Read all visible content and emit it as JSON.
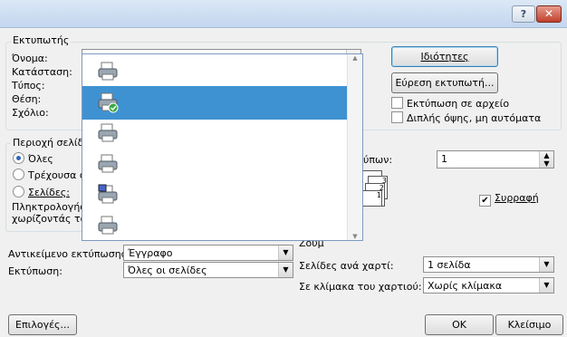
{
  "window": {
    "help": "?",
    "close": "✕"
  },
  "printer_group": {
    "title": "Εκτυπωτής",
    "name_label": "Όνομα:",
    "status_label": "Κατάσταση:",
    "type_label": "Τύπος:",
    "where_label": "Θέση:",
    "comment_label": "Σχόλιο:",
    "properties_button": "Ιδιότητες",
    "find_printer_button": "Εύρεση εκτυπωτή...",
    "print_to_file": "Εκτύπωση σε αρχείο",
    "manual_duplex": "Διπλής όψης, μη αυτόματα",
    "printer_items": [
      {
        "icon": "printer-icon",
        "selected": false
      },
      {
        "icon": "printer-default-icon",
        "selected": true
      },
      {
        "icon": "printer-icon",
        "selected": false
      },
      {
        "icon": "printer-icon",
        "selected": false
      },
      {
        "icon": "fax-printer-icon",
        "selected": false
      },
      {
        "icon": "printer-icon",
        "selected": false
      }
    ]
  },
  "page_range": {
    "title": "Περιοχή σελίδω",
    "all": "Όλες",
    "current": "Τρέχουσα σ",
    "pages": "Σελίδες:",
    "hint_line1": "Πληκτρολογήσ",
    "hint_line2": "χωρίζοντάς το"
  },
  "copies": {
    "label": "ύπων:",
    "value": "1",
    "collate": "Συρραφή"
  },
  "zoom": {
    "title": "Ζουμ",
    "pages_per_sheet_label": "Σελίδες ανά χαρτί:",
    "pages_per_sheet_value": "1 σελίδα",
    "scale_label": "Σε κλίμακα του χαρτιού:",
    "scale_value": "Χωρίς κλίμακα"
  },
  "print_what_label": "Αντικείμενο εκτύπωσης:",
  "print_what_value": "Έγγραφο",
  "print_label": "Εκτύπωση:",
  "print_value": "Όλες οι σελίδες",
  "buttons": {
    "options": "Επιλογές...",
    "ok": "OK",
    "close": "Κλείσιμο"
  }
}
